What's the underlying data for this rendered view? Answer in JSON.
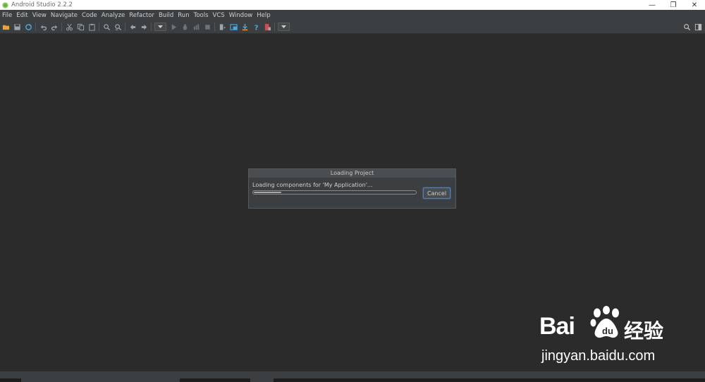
{
  "window": {
    "title": "Android Studio 2.2.2",
    "controls": [
      "—",
      "❐",
      "✕"
    ]
  },
  "menu": [
    {
      "label": "File"
    },
    {
      "label": "Edit"
    },
    {
      "label": "View"
    },
    {
      "label": "Navigate"
    },
    {
      "label": "Code"
    },
    {
      "label": "Analyze"
    },
    {
      "label": "Refactor"
    },
    {
      "label": "Build"
    },
    {
      "label": "Run"
    },
    {
      "label": "Tools"
    },
    {
      "label": "VCS"
    },
    {
      "label": "Window"
    },
    {
      "label": "Help"
    }
  ],
  "toolbar": {
    "icons": [
      "open-folder-icon",
      "save-all-icon",
      "sync-icon",
      "undo-icon",
      "redo-icon",
      "cut-icon",
      "copy-icon",
      "paste-icon",
      "find-icon",
      "replace-icon",
      "back-icon",
      "forward-icon",
      "run-config-select",
      "run-icon",
      "debug-icon",
      "attach-debugger-icon",
      "stop-icon",
      "sync-gradle-icon",
      "project-structure-icon",
      "sdk-manager-icon",
      "help-icon",
      "device-monitor-icon",
      "toolbar-dropdown"
    ],
    "right_icons": [
      "search-everywhere-icon",
      "layout-icon"
    ]
  },
  "dialog": {
    "title": "Loading Project",
    "message": "Loading components for 'My Application'...",
    "progress": 0.17,
    "cancel_label": "Cancel"
  },
  "watermark": {
    "brand": "Bai",
    "brand_cn": "经验",
    "url": "jingyan.baidu.com"
  },
  "colors": {
    "background": "#2b2b2b",
    "toolbar": "#3c3f41",
    "accent_button_border": "#5a7ea8"
  }
}
